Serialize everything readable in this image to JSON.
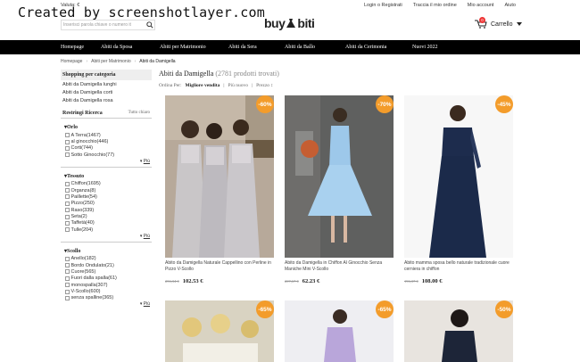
{
  "watermark": "Created by screenshotlayer.com",
  "header": {
    "valuta": "Valuta: €",
    "search_placeholder": "Inserisci parola chiave o numero it",
    "logo_left": "buy",
    "logo_right": "biti",
    "links": [
      "Login o Registrati",
      "Traccia il mio ordine",
      "Mio account",
      "Aiuto"
    ],
    "cart_label": "Carrello",
    "cart_count": "0"
  },
  "nav": [
    "Homepage",
    "Abiti da Sposa",
    "Abiti per Matrimonio",
    "Abiti da Sera",
    "Abiti da Ballo",
    "Abiti da Cerimonia",
    "Nuovi 2022"
  ],
  "breadcrumb": [
    "Homepage",
    "Abiti per Matrimonio",
    "Abiti da Damigella"
  ],
  "sidebar": {
    "shop_title": "Shopping per categoria",
    "categories": [
      "Abiti da Damigella lunghi",
      "Abiti da Damigella corti",
      "Abiti da Damigella rosa"
    ],
    "refine_title": "Restringi Ricerca",
    "clear_all": "Tutto chiaro",
    "groups": [
      {
        "title": "Orlo",
        "options": [
          "A Terra(1467)",
          "al ginocchio(446)",
          "Corti(744)",
          "Sotto Ginocchio(77)"
        ],
        "more": "Più"
      },
      {
        "title": "Tessuto",
        "options": [
          "Chiffon(1695)",
          "Organza(8)",
          "Paillette(54)",
          "Pizzo(250)",
          "Raso(339)",
          "Seta(2)",
          "Taffetà(40)",
          "Tulle(204)"
        ],
        "more": "Più"
      },
      {
        "title": "Scollo",
        "options": [
          "Anello(182)",
          "Bordo Ondulato(21)",
          "Cuore(565)",
          "Fuori dalla spalla(61)",
          "monospalla(307)",
          "V-Scollo(600)",
          "senza spalline(365)"
        ],
        "more": "Più"
      }
    ]
  },
  "main": {
    "title": "Abiti da Damigella",
    "count": "(2781 prodotti trovati)",
    "sort_label": "Ordina Per:",
    "sort_options": [
      "Migliore vendita",
      "Più nuovo",
      "Prezzo"
    ],
    "products": [
      {
        "discount": "-60%",
        "name": "Abito da Damigella Naturale Cappellino con Perline in Pizzo V-Scollo",
        "old": "256,34 €",
        "price": "102.53 €"
      },
      {
        "discount": "-70%",
        "name": "Abito da Damigella in Chiffon Al Ginocchio Senza Maniche Mini V-Scollo",
        "old": "207,67 €",
        "price": "62.23 €"
      },
      {
        "discount": "-45%",
        "name": "Abito mamma sposa bello naturale tradizionale cuore cerniera in chiffon",
        "old": "196,37 €",
        "price": "108.00 €"
      },
      {
        "discount": "-65%"
      },
      {
        "discount": "-65%"
      },
      {
        "discount": "-50%"
      }
    ]
  },
  "colors": {
    "nav_bg": "#000000",
    "discount": "#f39c2b",
    "accent": "#e33333"
  }
}
